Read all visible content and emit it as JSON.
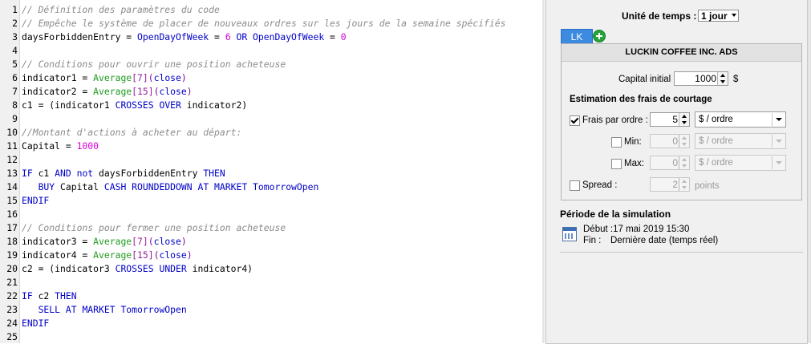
{
  "editor": {
    "lines": [
      {
        "n": "1",
        "tokens": [
          [
            "c-cmt",
            "// Définition des paramètres du code"
          ]
        ]
      },
      {
        "n": "2",
        "tokens": [
          [
            "c-cmt",
            "// Empêche le système de placer de nouveaux ordres sur les jours de la semaine spécifiés"
          ]
        ]
      },
      {
        "n": "3",
        "tokens": [
          [
            "c-id",
            "daysForbiddenEntry = "
          ],
          [
            "c-kw",
            "OpenDayOfWeek"
          ],
          [
            "c-id",
            " = "
          ],
          [
            "c-num",
            "6"
          ],
          [
            "c-id",
            " "
          ],
          [
            "c-kw",
            "OR"
          ],
          [
            "c-id",
            " "
          ],
          [
            "c-kw",
            "OpenDayOfWeek"
          ],
          [
            "c-id",
            " = "
          ],
          [
            "c-num",
            "0"
          ]
        ]
      },
      {
        "n": "4",
        "tokens": []
      },
      {
        "n": "5",
        "tokens": [
          [
            "c-cmt",
            "// Conditions pour ouvrir une position acheteuse"
          ]
        ]
      },
      {
        "n": "6",
        "tokens": [
          [
            "c-id",
            "indicator1 = "
          ],
          [
            "c-fn",
            "Average"
          ],
          [
            "c-br",
            "[7]"
          ],
          [
            "c-op",
            "("
          ],
          [
            "c-kw",
            "close"
          ],
          [
            "c-op",
            ")"
          ]
        ]
      },
      {
        "n": "7",
        "tokens": [
          [
            "c-id",
            "indicator2 = "
          ],
          [
            "c-fn",
            "Average"
          ],
          [
            "c-br",
            "[15]"
          ],
          [
            "c-op",
            "("
          ],
          [
            "c-kw",
            "close"
          ],
          [
            "c-op",
            ")"
          ]
        ]
      },
      {
        "n": "8",
        "tokens": [
          [
            "c-id",
            "c1 = (indicator1 "
          ],
          [
            "c-kw",
            "CROSSES OVER"
          ],
          [
            "c-id",
            " indicator2)"
          ]
        ]
      },
      {
        "n": "9",
        "tokens": []
      },
      {
        "n": "10",
        "tokens": [
          [
            "c-cmt",
            "//Montant d'actions à acheter au départ:"
          ]
        ]
      },
      {
        "n": "11",
        "tokens": [
          [
            "c-id",
            "Capital = "
          ],
          [
            "c-num",
            "1000"
          ]
        ]
      },
      {
        "n": "12",
        "tokens": []
      },
      {
        "n": "13",
        "tokens": [
          [
            "c-kw",
            "IF"
          ],
          [
            "c-id",
            " c1 "
          ],
          [
            "c-kw",
            "AND not"
          ],
          [
            "c-id",
            " daysForbiddenEntry "
          ],
          [
            "c-kw",
            "THEN"
          ]
        ]
      },
      {
        "n": "14",
        "tokens": [
          [
            "c-id",
            "   "
          ],
          [
            "c-kw",
            "BUY"
          ],
          [
            "c-id",
            " Capital "
          ],
          [
            "c-kw",
            "CASH ROUNDEDDOWN AT MARKET TomorrowOpen"
          ]
        ]
      },
      {
        "n": "15",
        "tokens": [
          [
            "c-kw",
            "ENDIF"
          ]
        ]
      },
      {
        "n": "16",
        "tokens": []
      },
      {
        "n": "17",
        "tokens": [
          [
            "c-cmt",
            "// Conditions pour fermer une position acheteuse"
          ]
        ]
      },
      {
        "n": "18",
        "tokens": [
          [
            "c-id",
            "indicator3 = "
          ],
          [
            "c-fn",
            "Average"
          ],
          [
            "c-br",
            "[7]"
          ],
          [
            "c-op",
            "("
          ],
          [
            "c-kw",
            "close"
          ],
          [
            "c-op",
            ")"
          ]
        ]
      },
      {
        "n": "19",
        "tokens": [
          [
            "c-id",
            "indicator4 = "
          ],
          [
            "c-fn",
            "Average"
          ],
          [
            "c-br",
            "[15]"
          ],
          [
            "c-op",
            "("
          ],
          [
            "c-kw",
            "close"
          ],
          [
            "c-op",
            ")"
          ]
        ]
      },
      {
        "n": "20",
        "tokens": [
          [
            "c-id",
            "c2 = (indicator3 "
          ],
          [
            "c-kw",
            "CROSSES UNDER"
          ],
          [
            "c-id",
            " indicator4)"
          ]
        ]
      },
      {
        "n": "21",
        "tokens": []
      },
      {
        "n": "22",
        "tokens": [
          [
            "c-kw",
            "IF"
          ],
          [
            "c-id",
            " c2 "
          ],
          [
            "c-kw",
            "THEN"
          ]
        ]
      },
      {
        "n": "23",
        "tokens": [
          [
            "c-id",
            "   "
          ],
          [
            "c-kw",
            "SELL AT MARKET TomorrowOpen"
          ]
        ]
      },
      {
        "n": "24",
        "tokens": [
          [
            "c-kw",
            "ENDIF"
          ]
        ]
      },
      {
        "n": "25",
        "tokens": []
      }
    ]
  },
  "panel": {
    "time_unit_label": "Unité de temps :",
    "time_unit_value": "1 jour",
    "tab_label": "LK",
    "asset_name": "LUCKIN COFFEE INC. ADS",
    "capital_label": "Capital initial :",
    "capital_value": "1000",
    "capital_currency": "$",
    "fees_title": "Estimation des frais de courtage",
    "fee_per_order": {
      "label": "Frais par ordre :",
      "checked": true,
      "value": "5",
      "unit": "$ / ordre"
    },
    "fee_min": {
      "label": "Min:",
      "checked": false,
      "value": "0",
      "unit": "$ / ordre"
    },
    "fee_max": {
      "label": "Max:",
      "checked": false,
      "value": "0",
      "unit": "$ / ordre"
    },
    "spread": {
      "label": "Spread :",
      "checked": false,
      "value": "2",
      "unit": "points"
    },
    "simulation_title": "Période de la simulation",
    "start_text": "Début :17 mai 2019 15:30",
    "end_label": "Fin :",
    "end_value": "Dernière date (temps réel)"
  }
}
